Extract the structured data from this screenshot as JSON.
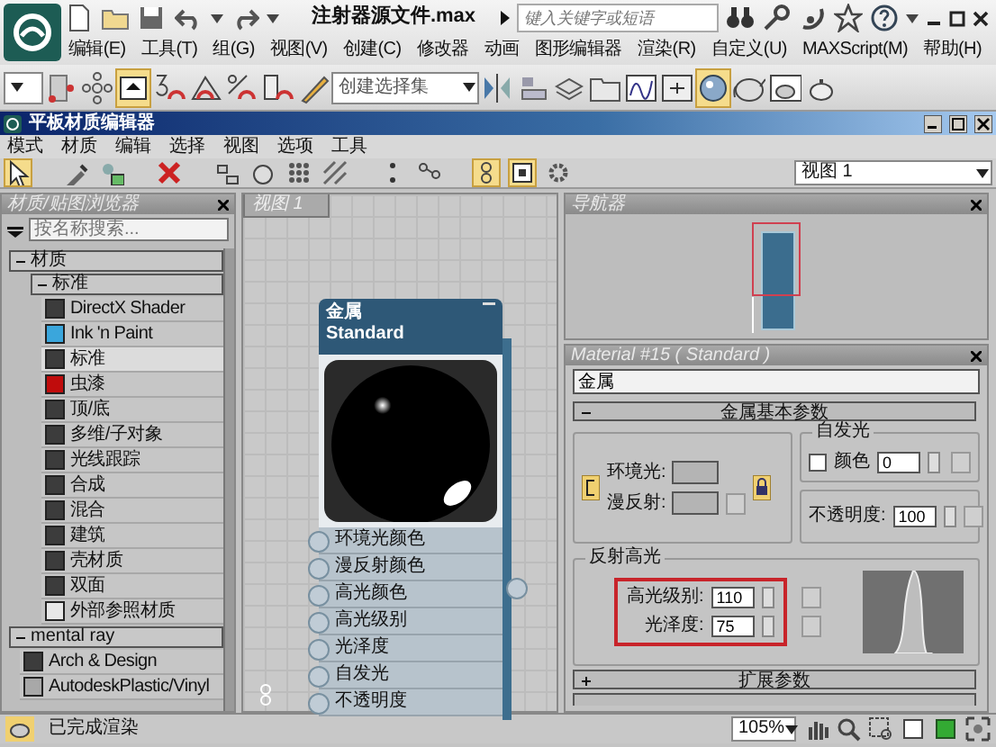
{
  "app": {
    "title": "注射器源文件.max",
    "search_placeholder": "键入关键字或短语",
    "menu": [
      "编辑(E)",
      "工具(T)",
      "组(G)",
      "视图(V)",
      "创建(C)",
      "修改器",
      "动画",
      "图形编辑器",
      "渲染(R)",
      "自定义(U)",
      "MAXScript(M)",
      "帮助(H)"
    ]
  },
  "main_toolbar": {
    "selection_set_placeholder": "创建选择集",
    "buttons": [
      {
        "active": false
      },
      {
        "active": false
      },
      {
        "active": true
      },
      {
        "active": false
      },
      {
        "active": false
      },
      {
        "active": false
      },
      {
        "active": false
      },
      {
        "active": false
      },
      {
        "active": false
      },
      {
        "active": false
      },
      {
        "active": false
      },
      {
        "active": false
      },
      {
        "active": false
      },
      {
        "active": false
      },
      {
        "active": true
      },
      {
        "active": false
      },
      {
        "active": false
      },
      {
        "active": false
      }
    ]
  },
  "editor": {
    "title": "平板材质编辑器",
    "menu": [
      "模式",
      "材质",
      "编辑",
      "选择",
      "视图",
      "选项",
      "工具"
    ],
    "toolbar": [
      {
        "active": true
      },
      {
        "active": false
      },
      {
        "active": false
      },
      {
        "active": false
      },
      {
        "active": false
      },
      {
        "active": false
      },
      {
        "active": false
      },
      {
        "active": false
      },
      {
        "active": false
      },
      {
        "active": false
      },
      {
        "active": true
      },
      {
        "active": true
      },
      {
        "active": false
      }
    ],
    "view_select": "视图 1",
    "browser": {
      "title": "材质/贴图浏览器",
      "search_placeholder": "按名称搜索...",
      "tree": [
        {
          "kind": "group",
          "label": "材质",
          "expanded": true,
          "children": [
            {
              "kind": "group",
              "label": "标准",
              "expanded": true,
              "children": [
                {
                  "kind": "material",
                  "label": "DirectX Shader",
                  "color": "#3c3c3c",
                  "selected": false
                },
                {
                  "kind": "material",
                  "label": "Ink 'n Paint",
                  "color": "#3aa6dc",
                  "selected": false
                },
                {
                  "kind": "material",
                  "label": "标准",
                  "color": "#3c3c3c",
                  "selected": true
                },
                {
                  "kind": "material",
                  "label": "虫漆",
                  "color": "#c00c0c",
                  "selected": false
                },
                {
                  "kind": "material",
                  "label": "顶/底",
                  "color": "#3c3c3c",
                  "selected": false
                },
                {
                  "kind": "material",
                  "label": "多维/子对象",
                  "color": "#3c3c3c",
                  "selected": false
                },
                {
                  "kind": "material",
                  "label": "光线跟踪",
                  "color": "#3c3c3c",
                  "selected": false
                },
                {
                  "kind": "material",
                  "label": "合成",
                  "color": "#3c3c3c",
                  "selected": false
                },
                {
                  "kind": "material",
                  "label": "混合",
                  "color": "#3c3c3c",
                  "selected": false
                },
                {
                  "kind": "material",
                  "label": "建筑",
                  "color": "#3c3c3c",
                  "selected": false
                },
                {
                  "kind": "material",
                  "label": "壳材质",
                  "color": "#3c3c3c",
                  "selected": false
                },
                {
                  "kind": "material",
                  "label": "双面",
                  "color": "#3c3c3c",
                  "selected": false
                },
                {
                  "kind": "material",
                  "label": "外部参照材质",
                  "color": "#e8e8e8",
                  "selected": false
                }
              ]
            }
          ]
        },
        {
          "kind": "group",
          "label": "mental ray",
          "expanded": true,
          "children": [
            {
              "kind": "material",
              "label": "Arch & Design",
              "color": "#3c3c3c",
              "selected": false
            },
            {
              "kind": "material",
              "label": "AutodeskPlastic/Vinyl",
              "color": "#a8a8a8",
              "selected": false
            }
          ]
        }
      ]
    },
    "canvas": {
      "tab": "视图 1",
      "node": {
        "title": "金属",
        "subtitle": "Standard",
        "slots": [
          "环境光颜色",
          "漫反射颜色",
          "高光颜色",
          "高光级别",
          "光泽度",
          "自发光",
          "不透明度"
        ]
      }
    },
    "navigator": {
      "title": "导航器"
    },
    "params": {
      "title": "Material #15 ( Standard )",
      "name": "金属",
      "rollouts": [
        {
          "label": "金属基本参数",
          "expanded": true
        },
        {
          "label": "扩展参数",
          "expanded": false
        }
      ],
      "ambient_label": "环境光:",
      "diffuse_label": "漫反射:",
      "self_illum": {
        "title": "自发光",
        "color_label": "颜色",
        "checked": false,
        "value": "0"
      },
      "opacity": {
        "label": "不透明度:",
        "value": "100"
      },
      "specular": {
        "title": "反射高光",
        "level_label": "高光级别:",
        "level_value": "110",
        "gloss_label": "光泽度:",
        "gloss_value": "75"
      }
    }
  },
  "status_bar": {
    "text": "已完成渲染",
    "zoom": "105%"
  }
}
